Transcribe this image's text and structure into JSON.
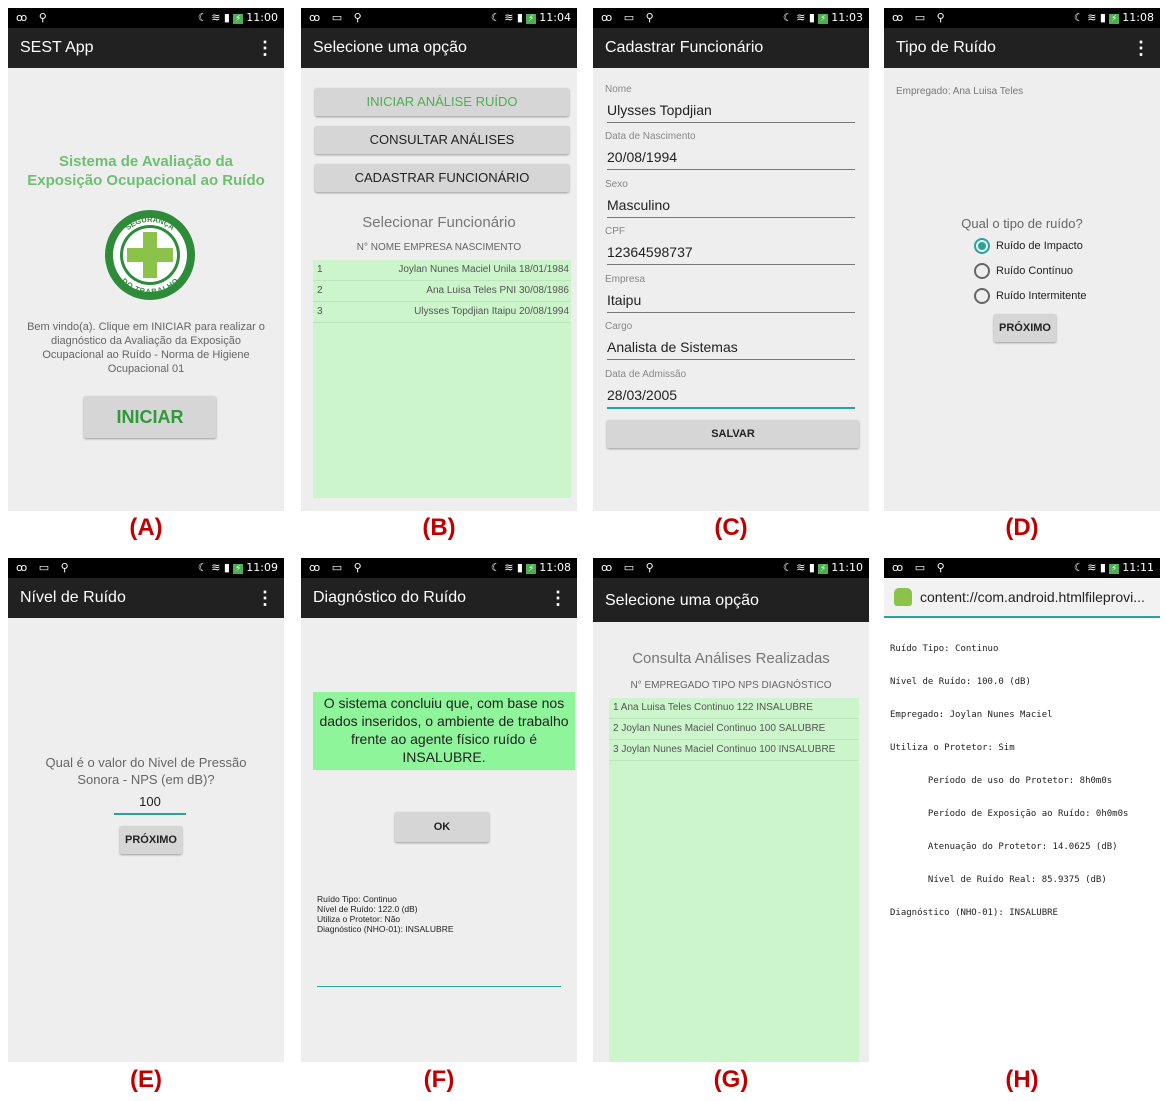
{
  "labels": [
    "(A)",
    "(B)",
    "(C)",
    "(D)",
    "(E)",
    "(F)",
    "(G)",
    "(H)"
  ],
  "status": {
    "a": "11:00",
    "b": "11:04",
    "c": "11:03",
    "d": "11:08",
    "e": "11:09",
    "f": "11:08",
    "g": "11:10",
    "h": "11:11"
  },
  "a": {
    "title": "SEST App",
    "heading": "Sistema de Avaliação da Exposição Ocupacional ao Ruído",
    "logo_top": "SEGURANÇA",
    "logo_bottom": "DO TRABALHO",
    "welcome": "Bem vindo(a). Clique em INICIAR para realizar o diagnóstico da Avaliação da Exposição Ocupacional ao Ruído - Norma de Higiene Ocupacional 01",
    "start": "INICIAR"
  },
  "b": {
    "title": "Selecione uma opção",
    "btn1": "INICIAR ANÁLISE RUÍDO",
    "btn2": "CONSULTAR ANÁLISES",
    "btn3": "CADASTRAR FUNCIONÁRIO",
    "subtitle": "Selecionar Funcionário",
    "header": "N° NOME EMPRESA NASCIMENTO",
    "rows": [
      {
        "n": "1",
        "text": "Joylan Nunes Maciel Unila 18/01/1984"
      },
      {
        "n": "2",
        "text": "Ana Luisa Teles PNI 30/08/1986"
      },
      {
        "n": "3",
        "text": "Ulysses Topdjian Itaipu 20/08/1994"
      }
    ]
  },
  "c": {
    "title": "Cadastrar Funcionário",
    "fields": [
      {
        "label": "Nome",
        "value": "Ulysses Topdjian"
      },
      {
        "label": "Data de Nascimento",
        "value": "20/08/1994"
      },
      {
        "label": "Sexo",
        "value": "Masculino"
      },
      {
        "label": "CPF",
        "value": "12364598737"
      },
      {
        "label": "Empresa",
        "value": "Itaipu"
      },
      {
        "label": "Cargo",
        "value": "Analista de Sistemas"
      },
      {
        "label": "Data de Admissão",
        "value": "28/03/2005"
      }
    ],
    "save": "SALVAR"
  },
  "d": {
    "title": "Tipo de Ruído",
    "employee": "Empregado: Ana Luisa Teles",
    "question": "Qual o tipo de ruído?",
    "options": [
      "Ruído de Impacto",
      "Ruído Contínuo",
      "Ruído Intermitente"
    ],
    "next": "PRÓXIMO"
  },
  "e": {
    "title": "Nível de Ruído",
    "question": "Qual é o valor do Nivel de Pressão Sonora - NPS (em dB)?",
    "value": "100",
    "next": "PRÓXIMO"
  },
  "f": {
    "title": "Diagnóstico do Ruído",
    "message": "O sistema concluiu que, com base nos dados inseridos, o ambiente de trabalho frente ao agente físico ruído é INSALUBRE.",
    "ok": "OK",
    "details": [
      "Ruído Tipo: Continuo",
      "Nível de Ruído: 122.0 (dB)",
      "Utiliza o Protetor: Não",
      "Diagnóstico (NHO-01): INSALUBRE"
    ]
  },
  "g": {
    "title": "Selecione uma opção",
    "subtitle": "Consulta Análises Realizadas",
    "header": "N° EMPREGADO TIPO NPS DIAGNÓSTICO",
    "rows": [
      "1 Ana Luisa Teles Continuo 122 INSALUBRE",
      "2 Joylan Nunes Maciel Continuo 100 SALUBRE",
      "3 Joylan Nunes Maciel Continuo 100 INSALUBRE"
    ]
  },
  "h": {
    "url": "content://com.android.htmlfileprovi...",
    "lines": [
      "Ruído Tipo: Continuo",
      "Nível de Ruído: 100.0 (dB)",
      "Empregado: Joylan Nunes Maciel",
      "Utiliza o Protetor: Sim",
      "       Período de uso do Protetor: 8h0m0s",
      "       Período de Exposição ao Ruído: 0h0m0s",
      "       Atenuação do Protetor: 14.0625 (dB)",
      "       Nível de Ruído Real: 85.9375 (dB)",
      "Diagnóstico (NHO-01): INSALUBRE"
    ]
  }
}
